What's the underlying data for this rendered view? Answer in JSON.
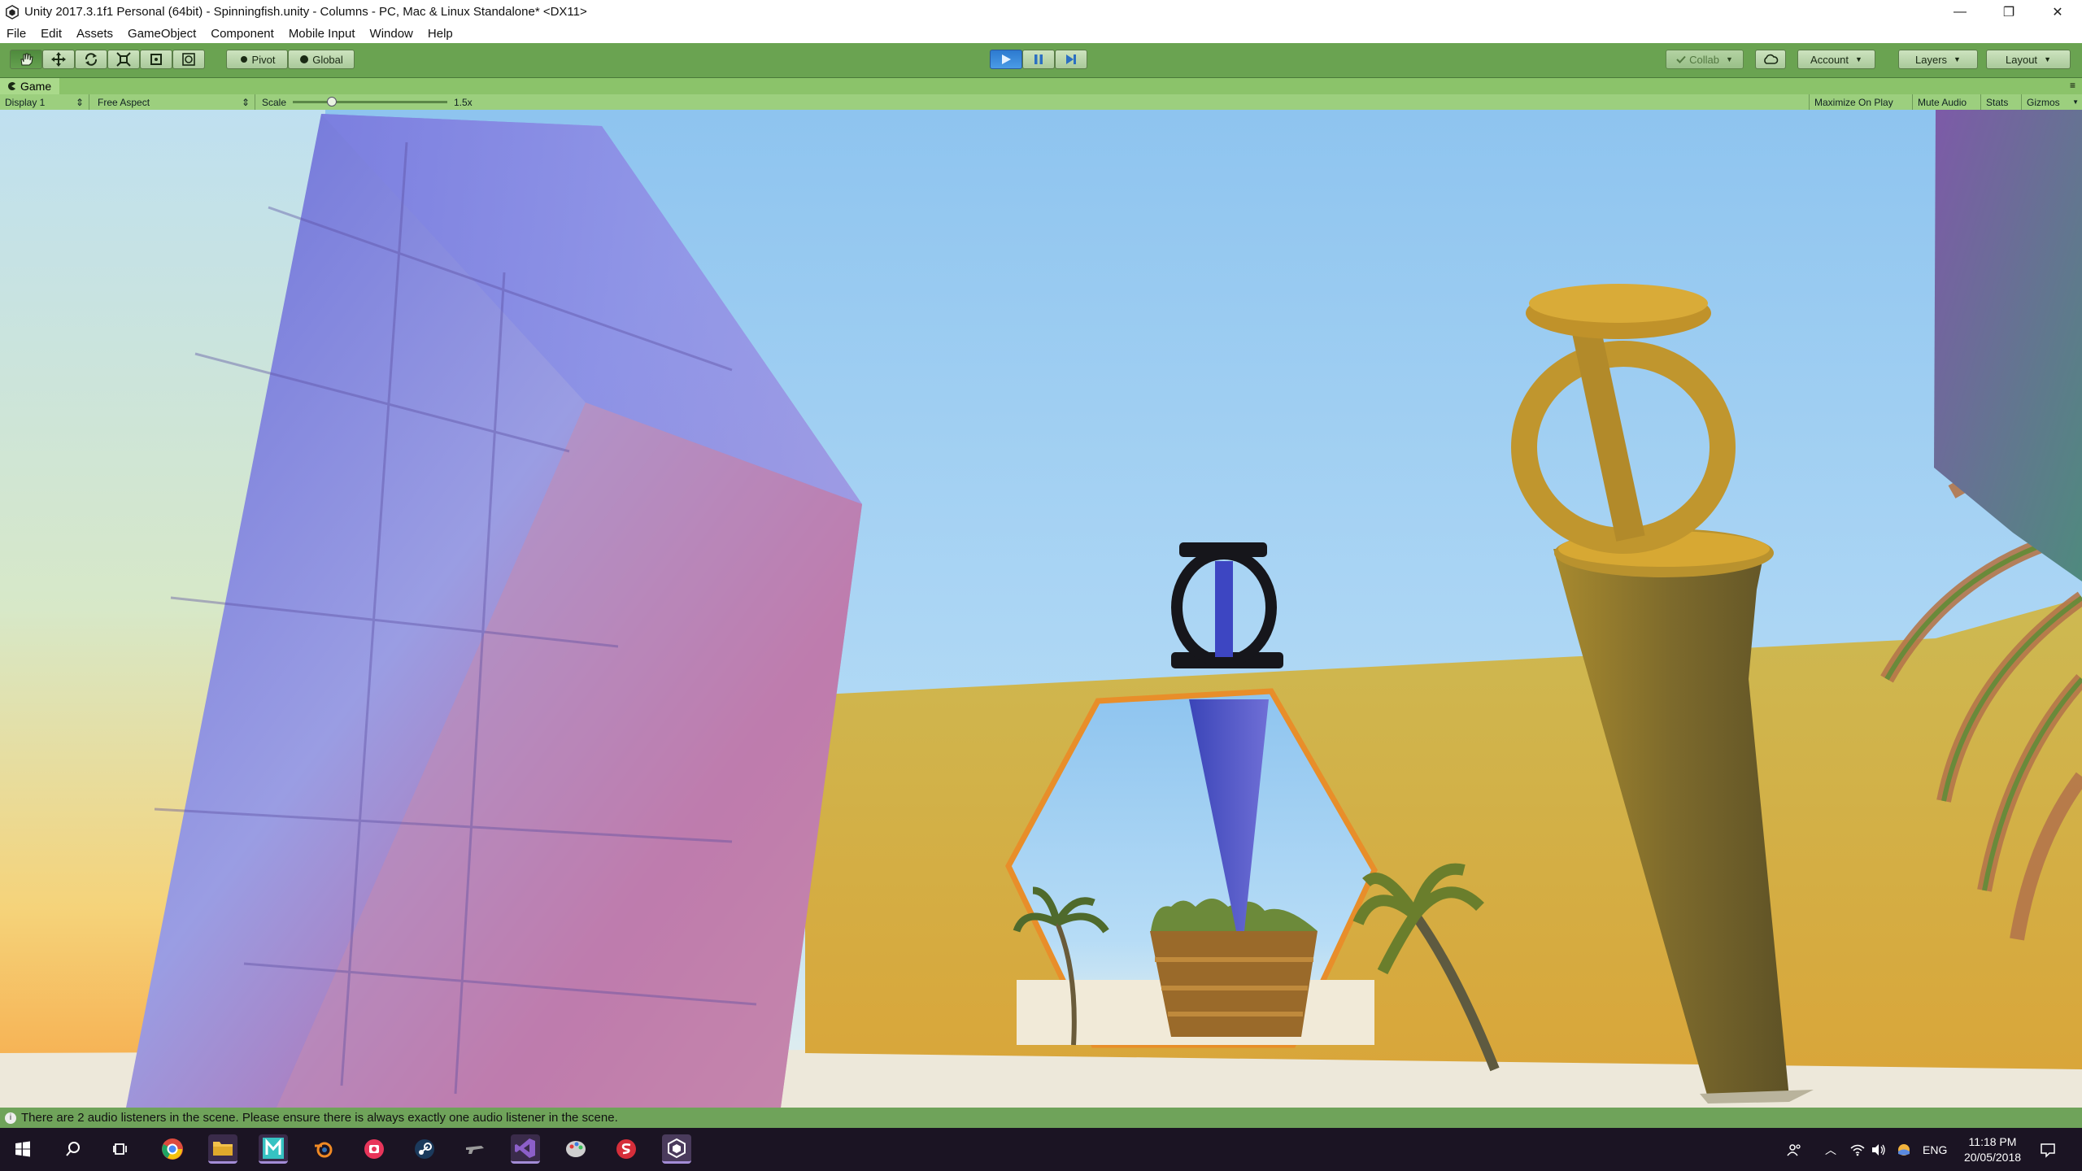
{
  "window": {
    "title": "Unity 2017.3.1f1 Personal (64bit) - Spinningfish.unity - Columns - PC, Mac & Linux Standalone* <DX11>",
    "minimize": "—",
    "maximize": "❐",
    "close": "✕"
  },
  "menu": [
    "File",
    "Edit",
    "Assets",
    "GameObject",
    "Component",
    "Mobile Input",
    "Window",
    "Help"
  ],
  "toolbar": {
    "pivot_label": "Pivot",
    "global_label": "Global",
    "collab_label": "Collab",
    "account_label": "Account",
    "layers_label": "Layers",
    "layout_label": "Layout",
    "play_state": "playing"
  },
  "game_tab": {
    "title": "Game",
    "display": "Display 1",
    "aspect": "Free Aspect",
    "scale_label": "Scale",
    "scale_value": "1.5x",
    "maximize_on_play": "Maximize On Play",
    "mute_audio": "Mute Audio",
    "stats": "Stats",
    "gizmos": "Gizmos"
  },
  "status": {
    "message": "There are 2 audio listeners in the scene. Please ensure there is always exactly one audio listener in the scene."
  },
  "taskbar": {
    "apps": [
      "windows-start",
      "search",
      "task-view",
      "chrome",
      "file-explorer",
      "mixamo",
      "blender",
      "screen-recorder",
      "steam",
      "game-app",
      "visual-studio",
      "paint-app",
      "substance",
      "unity"
    ],
    "active_app": "unity",
    "language": "ENG",
    "time": "11:18 PM",
    "date": "20/05/2018"
  },
  "colors": {
    "toolbar_bg": "#6aa351",
    "tab_bg": "#8bc36a",
    "status_bg": "#6fa35a",
    "taskbar_bg": "#1b1423",
    "play_blue": "#2d7acf"
  }
}
